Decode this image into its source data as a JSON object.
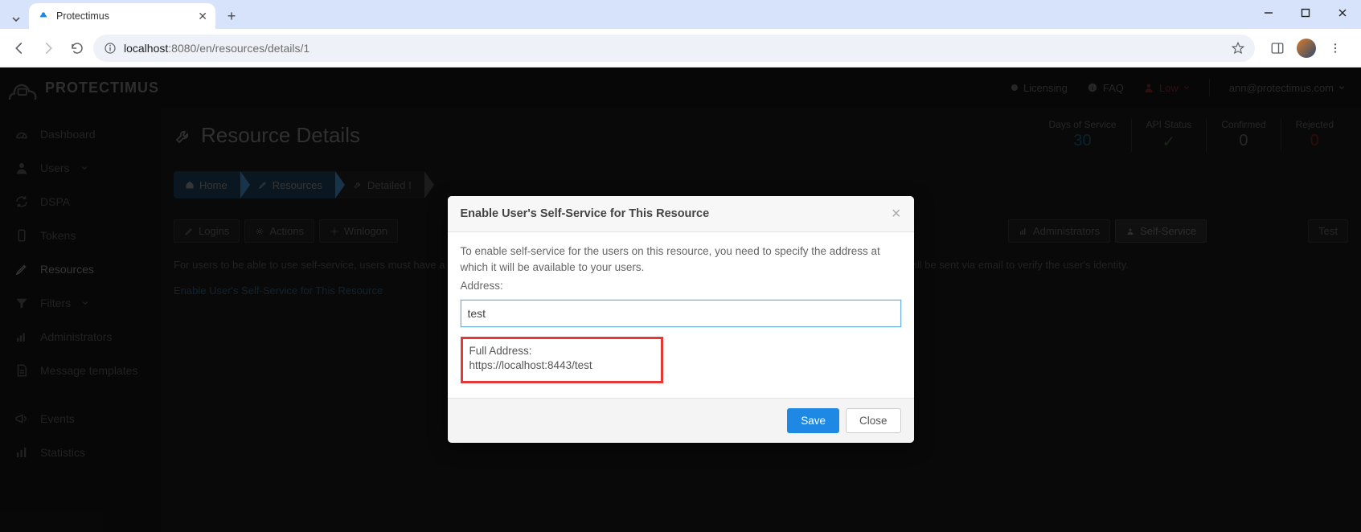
{
  "browser": {
    "tab_title": "Protectimus",
    "url_host": "localhost",
    "url_port_path": ":8080/en/resources/details/1"
  },
  "header": {
    "brand": "PROTECTIMUS",
    "licensing": "Licensing",
    "faq": "FAQ",
    "level": "Low",
    "email": "ann@protectimus.com"
  },
  "sidebar": {
    "items": [
      {
        "label": "Dashboard"
      },
      {
        "label": "Users"
      },
      {
        "label": "DSPA"
      },
      {
        "label": "Tokens"
      },
      {
        "label": "Resources"
      },
      {
        "label": "Filters"
      },
      {
        "label": "Administrators"
      },
      {
        "label": "Message templates"
      },
      {
        "label": "Events"
      },
      {
        "label": "Statistics"
      }
    ]
  },
  "page": {
    "title": "Resource Details",
    "stats": [
      {
        "label": "Days of Service",
        "value": "30",
        "cls": "blue"
      },
      {
        "label": "API Status",
        "value": "✓",
        "cls": "green"
      },
      {
        "label": "Confirmed",
        "value": "0",
        "cls": "zero"
      },
      {
        "label": "Rejected",
        "value": "0",
        "cls": "red"
      }
    ],
    "breadcrumbs": [
      {
        "label": "Home"
      },
      {
        "label": "Resources"
      },
      {
        "label": "Detailed I"
      }
    ],
    "tabs": [
      {
        "label": "Logins"
      },
      {
        "label": "Actions"
      },
      {
        "label": "Winlogon"
      },
      {
        "label": "Administrators"
      },
      {
        "label": "Self-Service"
      },
      {
        "label": "Test"
      }
    ],
    "body_text": "For users to be able to use self-service, users must have a password set. Users can authenticate users for self-service; if there is no password, a special code will be sent via email to verify the user's identity.",
    "body_link": "Enable User's Self-Service for This Resource"
  },
  "modal": {
    "title": "Enable User's Self-Service for This Resource",
    "desc": "To enable self-service for the users on this resource, you need to specify the address at which it will be available to your users.",
    "label": "Address:",
    "input_value": "test",
    "full_address_label": "Full Address: ",
    "full_address_value": "https://localhost:8443/test",
    "save": "Save",
    "close": "Close"
  }
}
